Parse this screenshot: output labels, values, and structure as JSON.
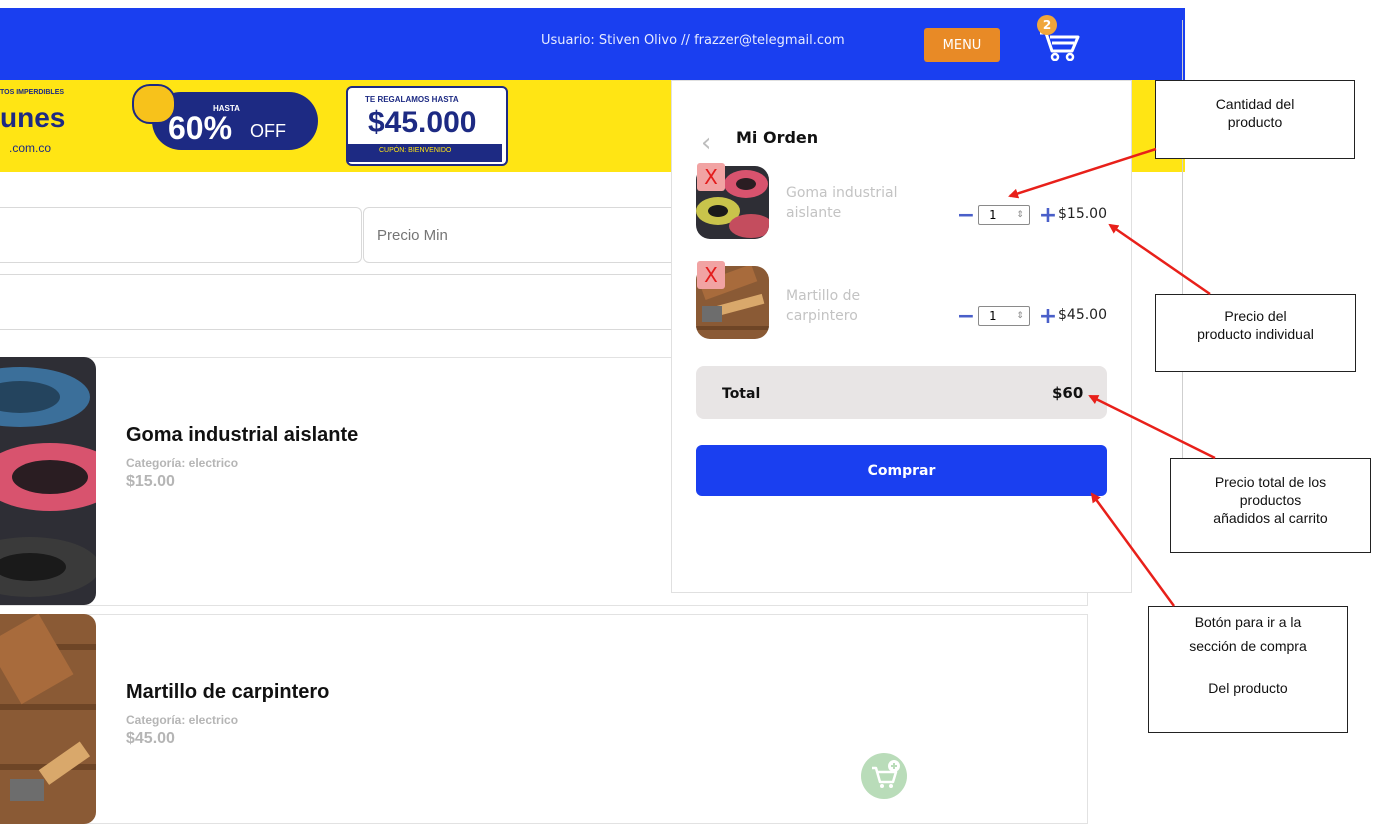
{
  "header": {
    "user_text": "Usuario: Stiven Olivo // frazzer@telegmail.com",
    "menu_label": "MENU",
    "cart_count": "2",
    "accent_color": "#1a3ff0"
  },
  "banner": {
    "promo_top": "TOS IMPERDIBLES",
    "brand": "unes",
    "brand_suffix": ".com.co",
    "hasta": "HASTA",
    "discount": "60%",
    "off": "OFF",
    "coupon_title": "TE REGALAMOS HASTA",
    "coupon_amount": "$45.000",
    "coupon_code": "CUPÓN: BIENVENIDO"
  },
  "filters": {
    "min_price_placeholder": "Precio Min"
  },
  "products": [
    {
      "name": "Goma industrial aislante",
      "category": "Categoría: electrico",
      "price": "$15.00"
    },
    {
      "name": "Martillo de carpintero",
      "category": "Categoría: electrico",
      "price": "$45.00"
    }
  ],
  "order": {
    "title": "Mi Orden",
    "remove_label": "X",
    "items": [
      {
        "name": "Goma industrial aislante",
        "qty": "1",
        "price": "$15.00"
      },
      {
        "name": "Martillo de carpintero",
        "qty": "1",
        "price": "$45.00"
      }
    ],
    "total_label": "Total",
    "total_value": "$60",
    "buy_label": "Comprar"
  },
  "callouts": {
    "qty": [
      "Cantidad del",
      "producto"
    ],
    "price": [
      "Precio del",
      "producto individual"
    ],
    "total": [
      "Precio total de los",
      "productos",
      "añadidos al carrito"
    ],
    "buy": [
      "Botón para ir a la",
      "sección de compra",
      "",
      "Del producto"
    ]
  }
}
